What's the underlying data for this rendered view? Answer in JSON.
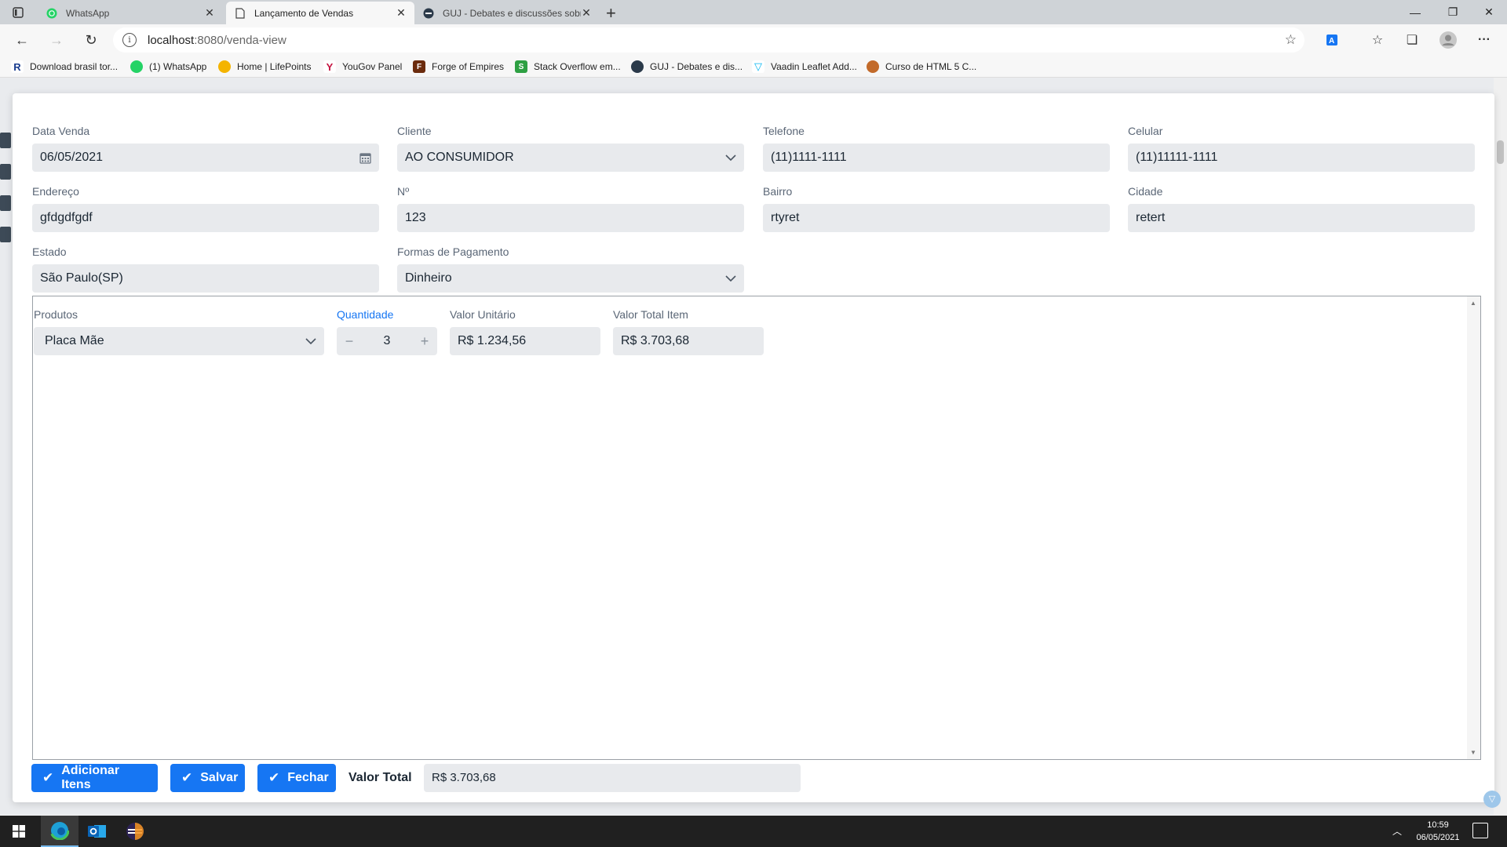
{
  "browser": {
    "tabs": [
      {
        "title": "WhatsApp",
        "icon": "whatsapp-icon",
        "active": false
      },
      {
        "title": "Lançamento de Vendas",
        "icon": "page-icon",
        "active": true
      },
      {
        "title": "GUJ - Debates e discussões sobr",
        "icon": "guj-icon",
        "active": false
      }
    ],
    "url_host": "localhost",
    "url_path": ":8080/venda-view",
    "bookmarks": [
      {
        "label": "Download brasil tor...",
        "icon": "r-icon",
        "color": "#1a3d8f"
      },
      {
        "label": "(1) WhatsApp",
        "icon": "whatsapp-icon",
        "color": "#25d366"
      },
      {
        "label": "Home | LifePoints",
        "icon": "lifepoints-icon",
        "color": "#f4b400"
      },
      {
        "label": "YouGov Panel",
        "icon": "yougov-icon",
        "color": "#c4123f"
      },
      {
        "label": "Forge of Empires",
        "icon": "forge-icon",
        "color": "#6b2b0d"
      },
      {
        "label": "Stack Overflow em...",
        "icon": "stackoverflow-icon",
        "color": "#2ea043"
      },
      {
        "label": "GUJ - Debates e dis...",
        "icon": "guj-icon",
        "color": "#2b3a4a"
      },
      {
        "label": "Vaadin Leaflet Add...",
        "icon": "vaadin-icon",
        "color": "#00b4f0"
      },
      {
        "label": "Curso de HTML 5 C...",
        "icon": "curso-icon",
        "color": "#c26a2a"
      }
    ]
  },
  "form": {
    "data_venda": {
      "label": "Data Venda",
      "value": "06/05/2021"
    },
    "cliente": {
      "label": "Cliente",
      "value": "AO CONSUMIDOR"
    },
    "telefone": {
      "label": "Telefone",
      "value": "(11)1111-1111"
    },
    "celular": {
      "label": "Celular",
      "value": "(11)11111-1111"
    },
    "endereco": {
      "label": "Endereço",
      "value": "gfdgdfgdf"
    },
    "numero": {
      "label": "Nº",
      "value": "123"
    },
    "bairro": {
      "label": "Bairro",
      "value": "rtyret"
    },
    "cidade": {
      "label": "Cidade",
      "value": "retert"
    },
    "estado": {
      "label": "Estado",
      "value": "São Paulo(SP)"
    },
    "pagamento": {
      "label": "Formas de Pagamento",
      "value": "Dinheiro"
    }
  },
  "item": {
    "produto": {
      "label": "Produtos",
      "value": "Placa Mãe"
    },
    "quantidade": {
      "label": "Quantidade",
      "value": "3"
    },
    "valor_unitario": {
      "label": "Valor Unitário",
      "value": "R$ 1.234,56"
    },
    "valor_total_item": {
      "label": "Valor Total Item",
      "value": "R$ 3.703,68"
    }
  },
  "actions": {
    "adicionar": "Adicionar Itens",
    "salvar": "Salvar",
    "fechar": "Fechar",
    "valor_total_label": "Valor Total",
    "valor_total": "R$ 3.703,68"
  },
  "taskbar": {
    "time": "10:59",
    "date": "06/05/2021"
  },
  "colors": {
    "accent": "#1676f3",
    "field_bg": "#e8eaed",
    "label": "#5a6676"
  }
}
